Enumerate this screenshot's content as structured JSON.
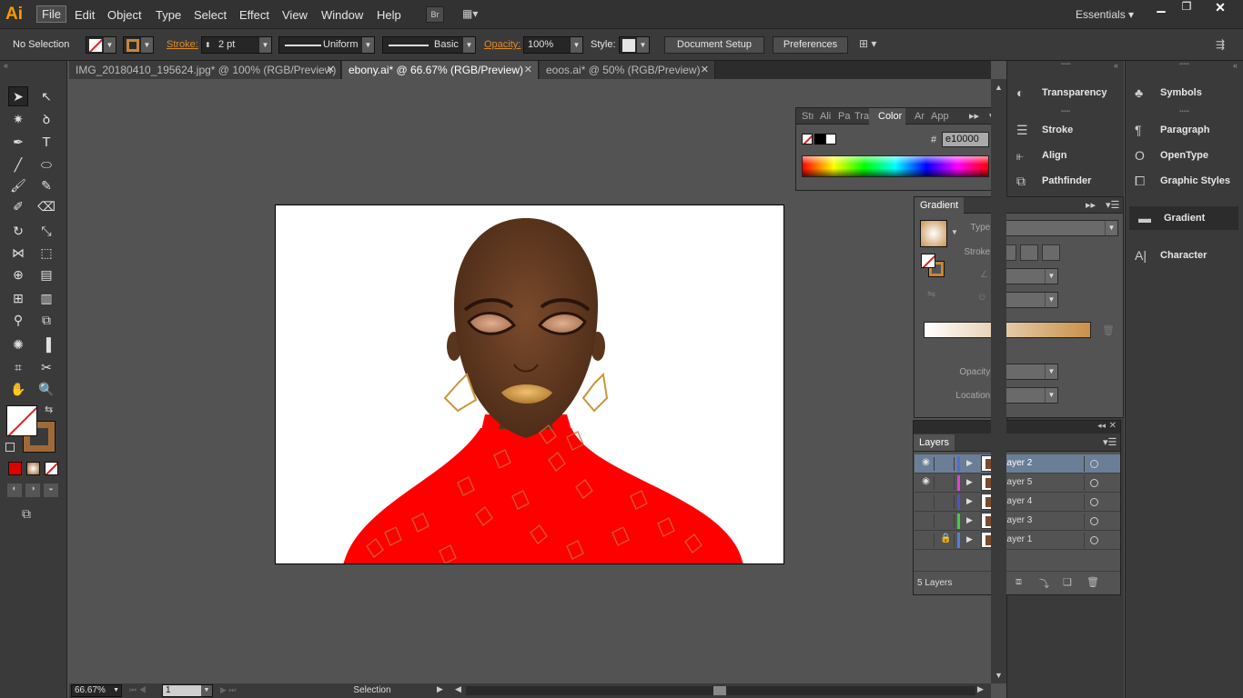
{
  "app": {
    "logo": "Ai",
    "workspace": "Essentials"
  },
  "menu": [
    "File",
    "Edit",
    "Object",
    "Type",
    "Select",
    "Effect",
    "View",
    "Window",
    "Help"
  ],
  "menu_active": "File",
  "bridge": "Br",
  "control": {
    "selection": "No Selection",
    "stroke_label": "Stroke:",
    "stroke_weight": "2 pt",
    "profile": "Uniform",
    "brush": "Basic",
    "opacity_label": "Opacity:",
    "opacity": "100%",
    "style_label": "Style:",
    "doc_setup": "Document Setup",
    "preferences": "Preferences"
  },
  "tabs": [
    {
      "label": "IMG_20180410_195624.jpg* @ 100% (RGB/Preview)",
      "active": false
    },
    {
      "label": "ebony.ai* @ 66.67% (RGB/Preview)",
      "active": true
    },
    {
      "label": "eoos.ai* @ 50% (RGB/Preview)",
      "active": false
    }
  ],
  "color_panel": {
    "tabs": [
      "Stı",
      "Ali",
      "Pa",
      "Tra",
      "Color",
      "Ar",
      "App"
    ],
    "active": "Color",
    "hex_label": "#",
    "hex": "e10000"
  },
  "gradient_panel": {
    "title": "Gradient",
    "type_label": "Type:",
    "stroke_label": "Stroke:",
    "opacity_label": "Opacity:",
    "location_label": "Location:"
  },
  "layers_panel": {
    "title": "Layers",
    "count": "5 Layers",
    "layers": [
      {
        "name": "Layer 2",
        "color": "#4f6fd0",
        "selected": true,
        "visible": true,
        "locked": false
      },
      {
        "name": "Layer 5",
        "color": "#e040e0",
        "selected": false,
        "visible": true,
        "locked": false
      },
      {
        "name": "Layer 4",
        "color": "#5050d0",
        "selected": false,
        "visible": false,
        "locked": false
      },
      {
        "name": "Layer 3",
        "color": "#40d040",
        "selected": false,
        "visible": false,
        "locked": false
      },
      {
        "name": "Layer 1",
        "color": "#4f7fe0",
        "selected": false,
        "visible": false,
        "locked": true
      }
    ]
  },
  "dock1": [
    "Transparency",
    "Stroke",
    "Align",
    "Pathfinder"
  ],
  "dock2": [
    "Symbols",
    "Paragraph",
    "OpenType",
    "Graphic Styles",
    "Gradient",
    "Character"
  ],
  "status": {
    "zoom": "66.67%",
    "page": "1",
    "tool": "Selection"
  },
  "colors": {
    "fill_red": "#ff0000",
    "skin": "#6b3f24",
    "gold": "#c8953f"
  }
}
